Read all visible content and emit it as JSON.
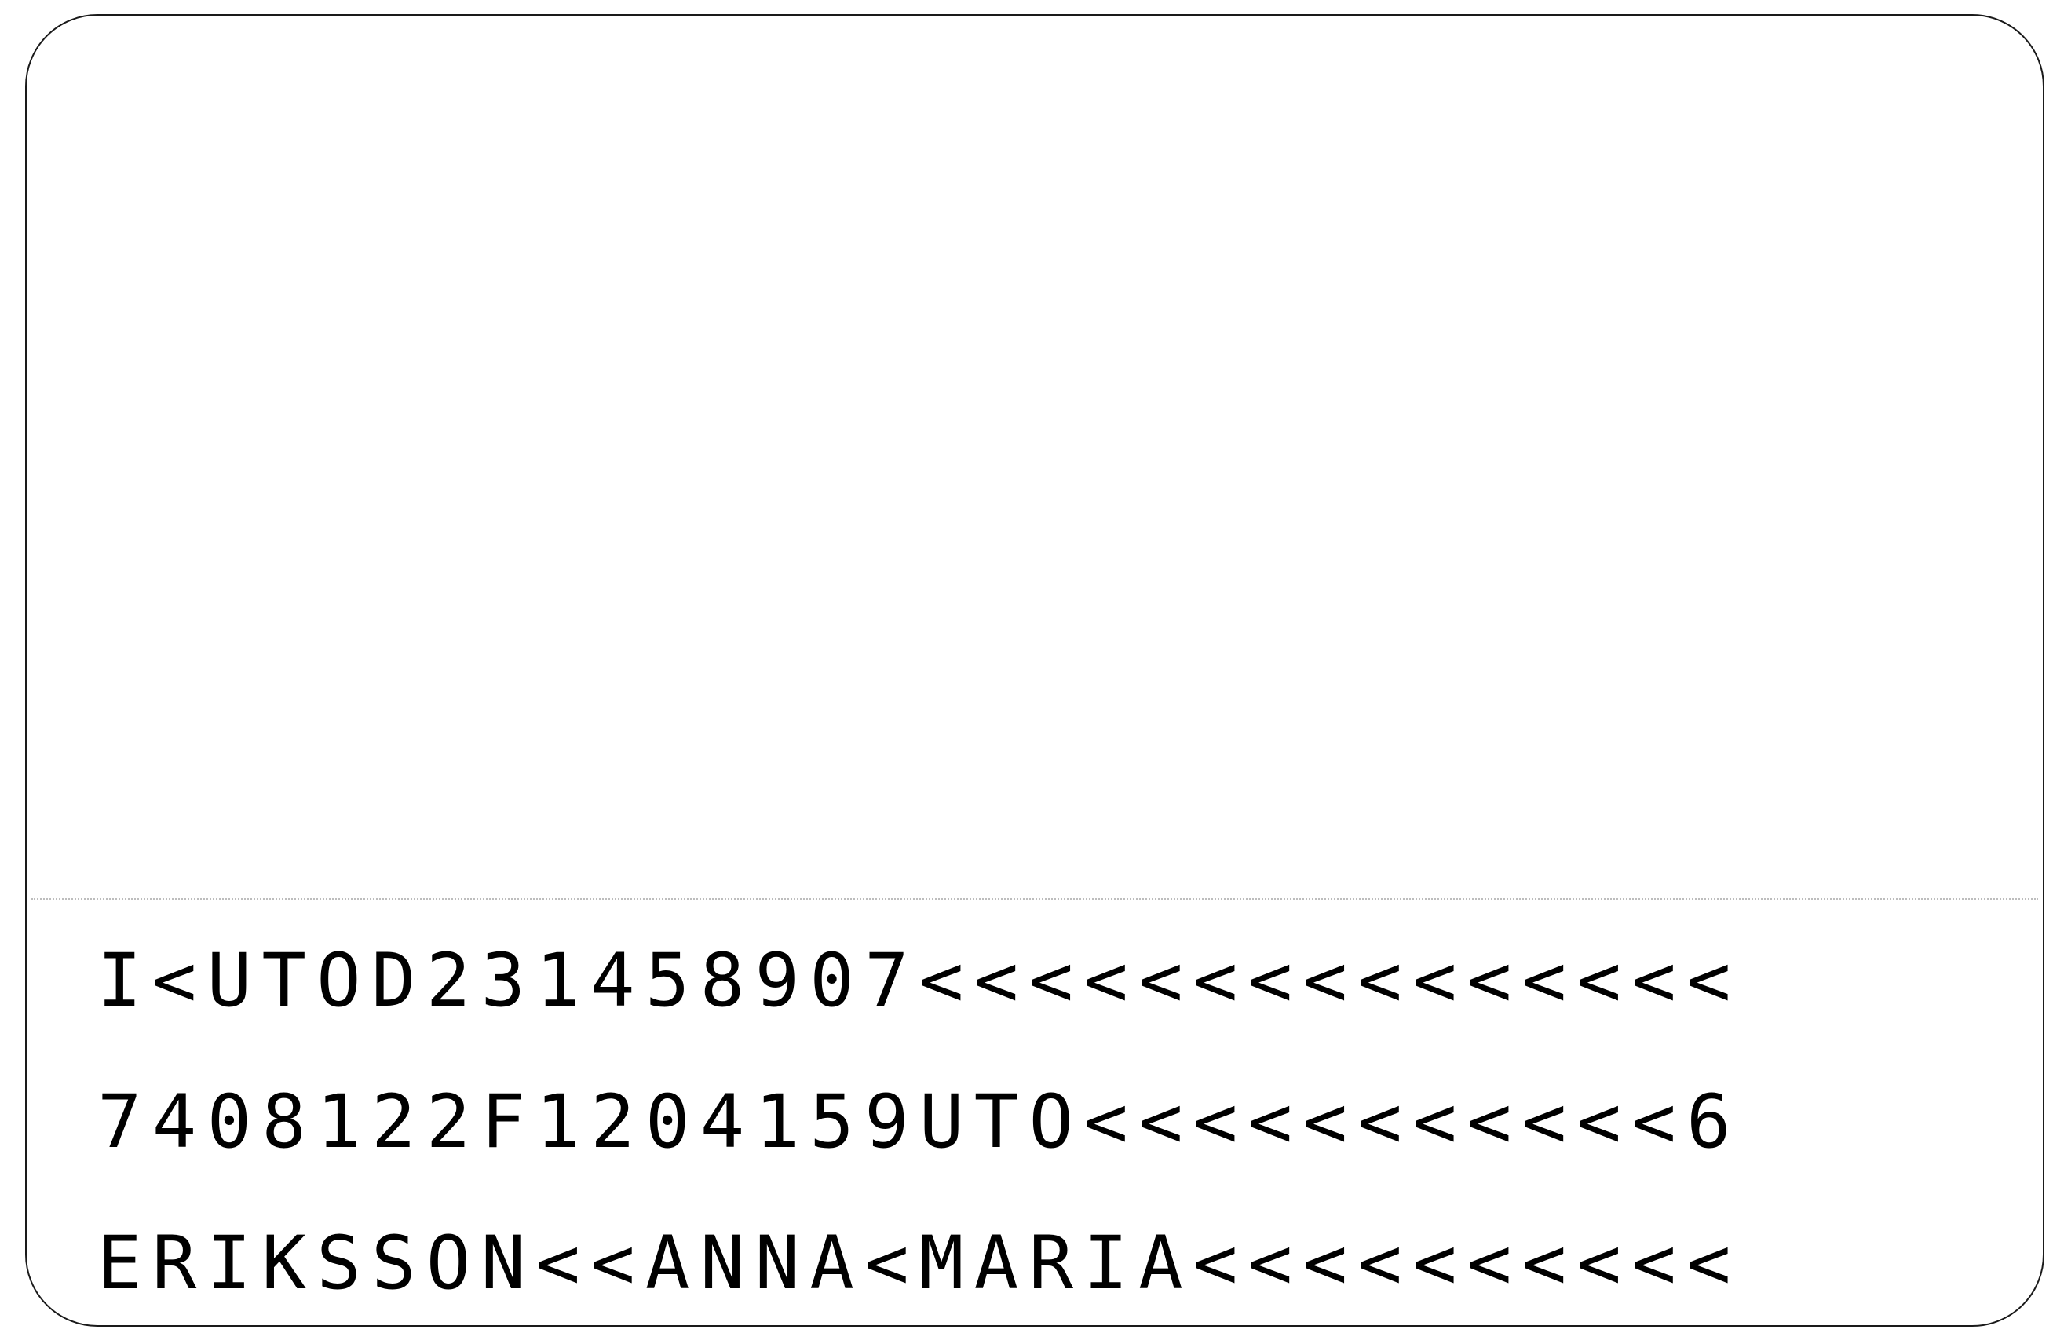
{
  "id_card_back": {
    "mrz": {
      "line_1": "I<UTOD231458907<<<<<<<<<<<<<<<",
      "line_2": "7408122F1204159UTO<<<<<<<<<<<6",
      "line_3": "ERIKSSON<<ANNA<MARIA<<<<<<<<<<"
    }
  }
}
